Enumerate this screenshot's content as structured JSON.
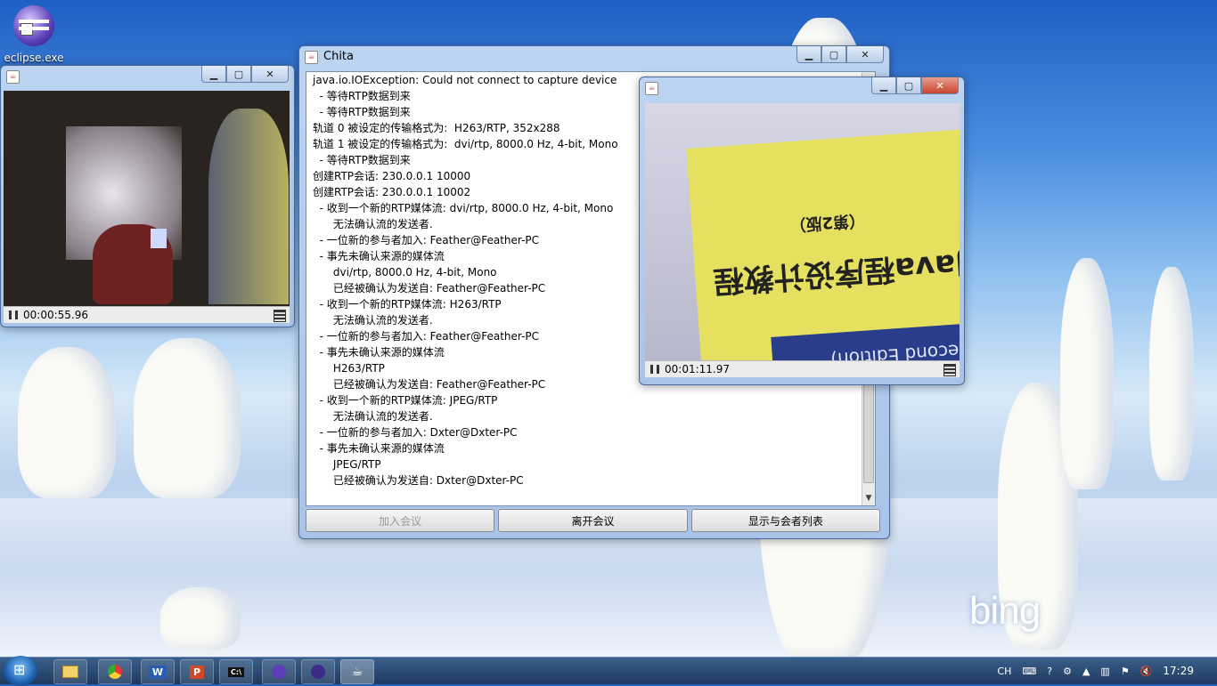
{
  "desktop": {
    "icon_label": "eclipse.exe",
    "watermark": "bing"
  },
  "left_player": {
    "time": "00:00:55.96"
  },
  "main_window": {
    "title": "Chita",
    "log_lines": [
      "java.io.IOException: Could not connect to capture device",
      "  - 等待RTP数据到来",
      "  - 等待RTP数据到来",
      "轨道 0 被设定的传输格式为:  H263/RTP, 352x288",
      "轨道 1 被设定的传输格式为:  dvi/rtp, 8000.0 Hz, 4-bit, Mono",
      "  - 等待RTP数据到来",
      "创建RTP会话: 230.0.0.1 10000",
      "创建RTP会话: 230.0.0.1 10002",
      "  - 收到一个新的RTP媒体流: dvi/rtp, 8000.0 Hz, 4-bit, Mono",
      "      无法确认流的发送者.",
      "  - 一位新的参与者加入: Feather@Feather-PC",
      "  - 事先未确认来源的媒体流",
      "      dvi/rtp, 8000.0 Hz, 4-bit, Mono",
      "      已经被确认为发送自: Feather@Feather-PC",
      "  - 收到一个新的RTP媒体流: H263/RTP",
      "      无法确认流的发送者.",
      "  - 一位新的参与者加入: Feather@Feather-PC",
      "  - 事先未确认来源的媒体流",
      "      H263/RTP",
      "      已经被确认为发送自: Feather@Feather-PC",
      "  - 收到一个新的RTP媒体流: JPEG/RTP",
      "      无法确认流的发送者.",
      "  - 一位新的参与者加入: Dxter@Dxter-PC",
      "  - 事先未确认来源的媒体流",
      "      JPEG/RTP",
      "      已经被确认为发送自: Dxter@Dxter-PC"
    ],
    "buttons": {
      "join": "加入会议",
      "leave": "离开会议",
      "show_participants": "显示与会者列表"
    }
  },
  "right_player": {
    "time": "00:01:11.97",
    "book_lines": [
      "Java程序设计教程",
      "（第2版）",
      "(Second Edition)"
    ]
  },
  "taskbar": {
    "buttons": [
      "explorer",
      "chrome",
      "W",
      "P",
      "C:\\",
      "eclipse",
      "eclipse",
      "java"
    ],
    "tray_lang": "CH",
    "clock": "17:29"
  }
}
